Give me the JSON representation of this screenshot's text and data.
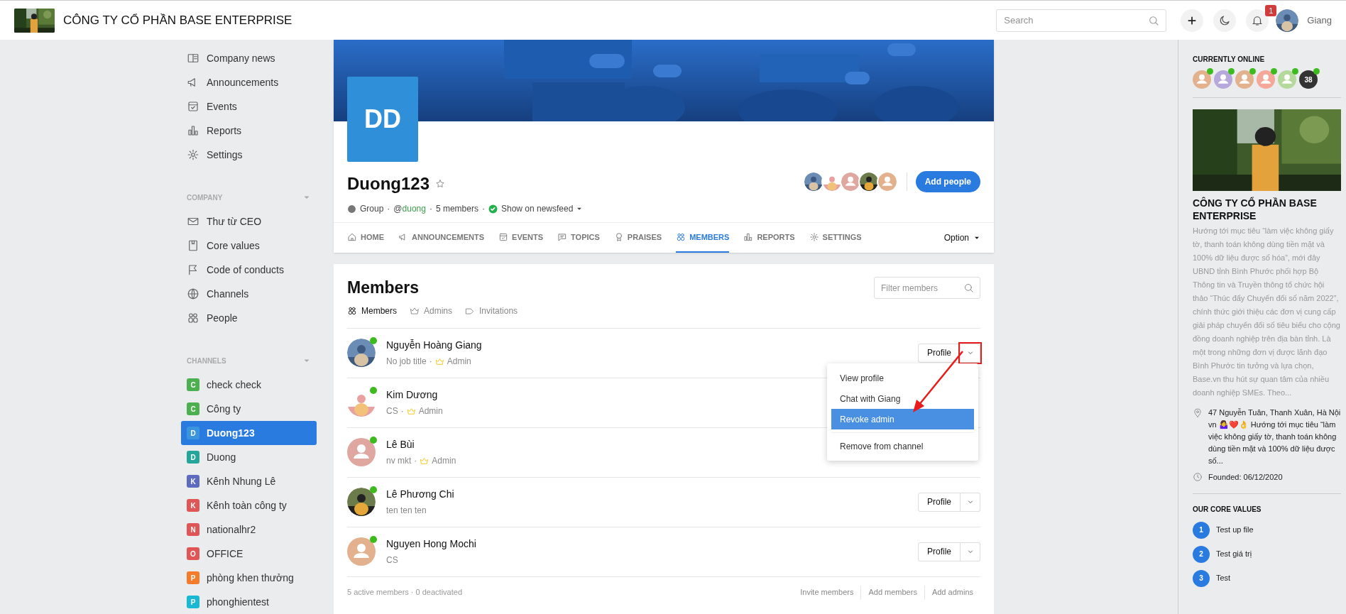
{
  "header": {
    "company": "CÔNG TY CỔ PHẦN BASE ENTERPRISE",
    "search_placeholder": "Search",
    "notification_count": "1",
    "user": "Giang"
  },
  "sidebar": {
    "items": [
      {
        "label": "Company news"
      },
      {
        "label": "Announcements"
      },
      {
        "label": "Events"
      },
      {
        "label": "Reports"
      },
      {
        "label": "Settings"
      }
    ],
    "sections": [
      {
        "title": "COMPANY",
        "items": [
          {
            "label": "Thư từ CEO"
          },
          {
            "label": "Core values"
          },
          {
            "label": "Code of conducts"
          },
          {
            "label": "Channels"
          },
          {
            "label": "People"
          }
        ]
      },
      {
        "title": "CHANNELS",
        "channels": [
          {
            "letter": "C",
            "label": "check check",
            "color": "#4caf50",
            "selected": false
          },
          {
            "letter": "C",
            "label": "Công ty",
            "color": "#4caf50",
            "selected": false
          },
          {
            "letter": "D",
            "label": "Duong123",
            "color": "#3a95de",
            "selected": true
          },
          {
            "letter": "D",
            "label": "Duong",
            "color": "#26a69a",
            "selected": false
          },
          {
            "letter": "K",
            "label": "Kênh Nhung Lê",
            "color": "#5c6bc0",
            "selected": false
          },
          {
            "letter": "K",
            "label": "Kênh toàn công ty",
            "color": "#e05555",
            "selected": false
          },
          {
            "letter": "N",
            "label": "nationalhr2",
            "color": "#e05555",
            "selected": false
          },
          {
            "letter": "O",
            "label": "OFFICE",
            "color": "#e05555",
            "selected": false
          },
          {
            "letter": "P",
            "label": "phòng khen thưởng",
            "color": "#f47b2a",
            "selected": false
          },
          {
            "letter": "P",
            "label": "phonghientest",
            "color": "#1ab8d4",
            "selected": false
          }
        ]
      }
    ]
  },
  "group": {
    "initials": "DD",
    "name": "Duong123",
    "meta": [
      {
        "kind": "type",
        "text": "Group"
      },
      {
        "kind": "separator",
        "text": "·"
      },
      {
        "kind": "handle",
        "prefix": "@",
        "text": "duong"
      },
      {
        "kind": "separator",
        "text": "·"
      },
      {
        "kind": "count",
        "text": "5 members"
      },
      {
        "kind": "separator",
        "text": "·"
      },
      {
        "kind": "newsfeed",
        "text": "Show on newsfeed"
      }
    ],
    "add_button": "Add people",
    "tabs": [
      {
        "label": "HOME",
        "selected": false
      },
      {
        "label": "ANNOUNCEMENTS",
        "selected": false
      },
      {
        "label": "EVENTS",
        "selected": false
      },
      {
        "label": "TOPICS",
        "selected": false
      },
      {
        "label": "PRAISES",
        "selected": false
      },
      {
        "label": "MEMBERS",
        "selected": true
      },
      {
        "label": "REPORTS",
        "selected": false
      },
      {
        "label": "SETTINGS",
        "selected": false
      }
    ],
    "option": "Option"
  },
  "members": {
    "title": "Members",
    "filter_placeholder": "Filter members",
    "subtabs": [
      {
        "label": "Members",
        "selected": true
      },
      {
        "label": "Admins",
        "selected": false
      },
      {
        "label": "Invitations",
        "selected": false
      }
    ],
    "rows": [
      {
        "name": "Nguyễn Hoàng Giang",
        "title": "No job title",
        "separator": "·",
        "role": "Admin",
        "online": true,
        "profile_button": "Profile"
      },
      {
        "name": "Kim Dương",
        "title": "CS",
        "separator": "·",
        "role": "Admin",
        "online": true
      },
      {
        "name": "Lê Bùi",
        "title": "nv mkt",
        "separator": "·",
        "role": "Admin",
        "kind": "placeholder",
        "online": true
      },
      {
        "name": "Lê Phương Chi",
        "title": "ten ten ten",
        "online": true,
        "profile_button": "Profile"
      },
      {
        "name": "Nguyen Hong Mochi",
        "title": "CS",
        "kind": "placeholder",
        "online": true,
        "profile_button": "Profile"
      }
    ],
    "menu": [
      {
        "label": "View profile",
        "selected": false
      },
      {
        "label": "Chat with Giang",
        "selected": false
      },
      {
        "label": "Revoke admin",
        "selected": true
      },
      {
        "label": "Remove from channel",
        "selected": false
      }
    ],
    "footer": "5 active members · 0 deactivated",
    "footer_links": [
      "Invite members",
      "Add members",
      "Add admins"
    ]
  },
  "right": {
    "online_title": "CURRENTLY ONLINE",
    "online": [
      {
        "color": "#e3b18e"
      },
      {
        "color": "#b7a8dc"
      },
      {
        "color": "#e3b18e"
      },
      {
        "color": "#f5a899"
      },
      {
        "color": "#b5d99c"
      }
    ],
    "online_more": "38",
    "company": "CÔNG TY CỔ PHẦN BASE ENTERPRISE",
    "description": "Hướng tới mục tiêu “làm việc không giấy tờ, thanh toán không dùng tiền mặt và 100% dữ liệu được số hóa”, mới đây UBND tỉnh Bình Phước phối hợp Bộ Thông tin và Truyền thông tổ chức hội thảo “Thúc đẩy Chuyển đổi số năm 2022”, chính thức giới thiệu các đơn vị cung cấp giải pháp chuyển đổi số tiêu biểu cho cộng đồng doanh nghiệp trên địa bàn tỉnh. Là một trong những đơn vị được lãnh đạo Bình Phước tin tưởng và lựa chọn, Base.vn thu hút sự quan tâm của nhiều doanh nghiệp SMEs. Theo...",
    "address": "47 Nguyễn Tuân, Thanh Xuân, Hà Nội vn 🤷‍♀️❤️👌 Hướng tới mục tiêu “làm việc không giấy tờ, thanh toán không dùng tiền mặt và 100% dữ liệu được số...",
    "founded": "Founded: 06/12/2020",
    "values_title": "OUR CORE VALUES",
    "values": [
      {
        "number": "1",
        "label": "Test up file"
      },
      {
        "number": "2",
        "label": "Test giá trị"
      },
      {
        "number": "3",
        "label": "Test"
      }
    ]
  }
}
